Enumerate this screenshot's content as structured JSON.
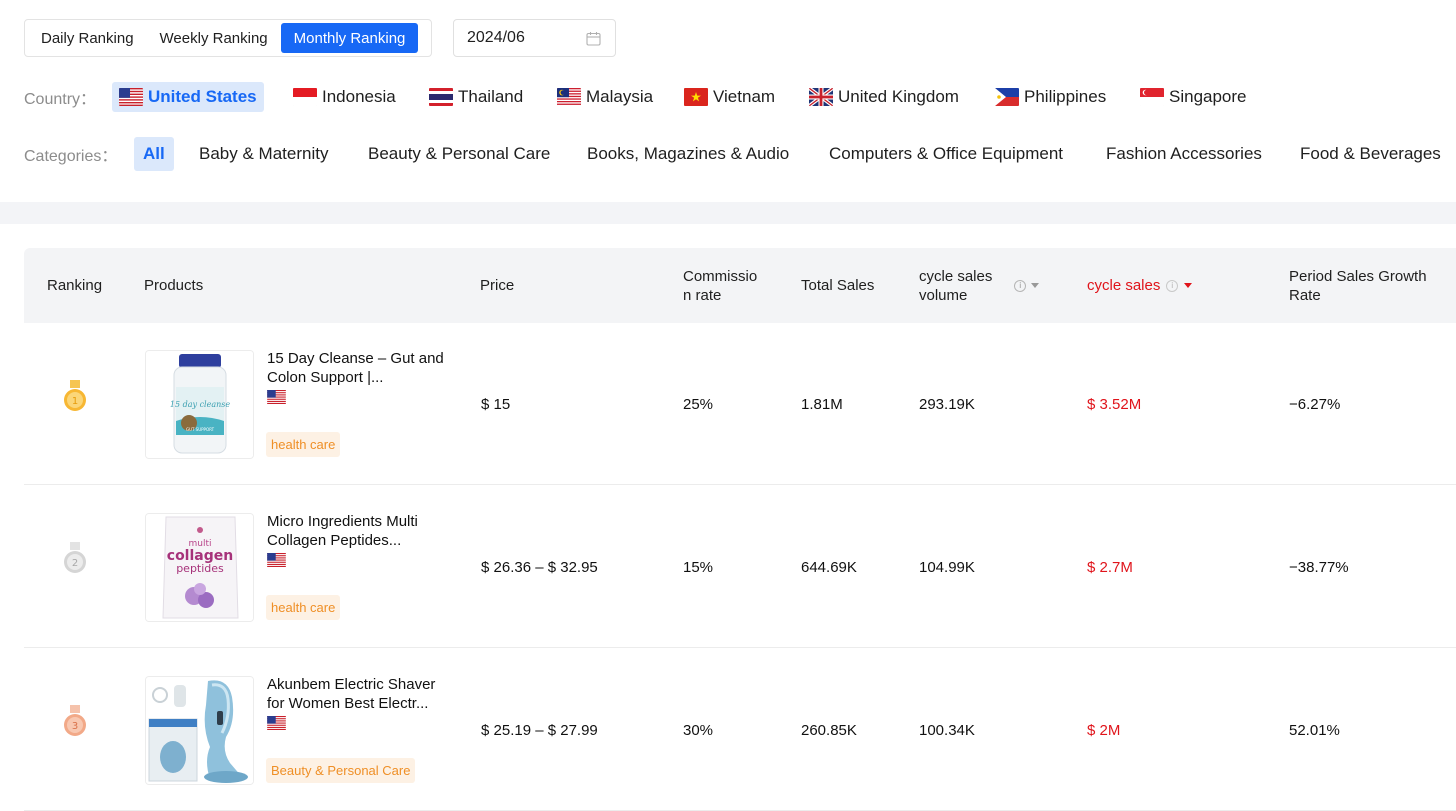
{
  "ranking_tabs": [
    {
      "label": "Daily Ranking",
      "active": false
    },
    {
      "label": "Weekly Ranking",
      "active": false
    },
    {
      "label": "Monthly Ranking",
      "active": true
    }
  ],
  "date_picker": {
    "value": "2024/06",
    "icon": "calendar-icon"
  },
  "country": {
    "label": "Country：",
    "items": [
      {
        "label": "United States",
        "flag": "us",
        "active": true
      },
      {
        "label": "Indonesia",
        "flag": "id",
        "active": false
      },
      {
        "label": "Thailand",
        "flag": "th",
        "active": false
      },
      {
        "label": "Malaysia",
        "flag": "my",
        "active": false
      },
      {
        "label": "Vietnam",
        "flag": "vn",
        "active": false
      },
      {
        "label": "United Kingdom",
        "flag": "gb",
        "active": false
      },
      {
        "label": "Philippines",
        "flag": "ph",
        "active": false
      },
      {
        "label": "Singapore",
        "flag": "sg",
        "active": false
      }
    ]
  },
  "categories": {
    "label": "Categories：",
    "items": [
      {
        "label": "All",
        "active": true
      },
      {
        "label": "Baby & Maternity",
        "active": false
      },
      {
        "label": "Beauty & Personal Care",
        "active": false
      },
      {
        "label": "Books, Magazines & Audio",
        "active": false
      },
      {
        "label": "Computers & Office Equipment",
        "active": false
      },
      {
        "label": "Fashion Accessories",
        "active": false
      },
      {
        "label": "Food & Beverages",
        "active": false
      }
    ]
  },
  "table": {
    "headers": {
      "ranking": "Ranking",
      "products": "Products",
      "price": "Price",
      "commission_line1": "Commissio",
      "commission_line2": "n rate",
      "total_sales": "Total Sales",
      "cycle_volume_line1": "cycle sales",
      "cycle_volume_line2": "volume",
      "cycle_sales": "cycle sales",
      "growth_line1": "Period Sales Growth",
      "growth_line2": "Rate"
    },
    "rows": [
      {
        "rank": "1",
        "medal": "gold",
        "name": "15 Day Cleanse – Gut and Colon Support |...",
        "tag": "health care",
        "price": "$ 15",
        "commission": "25%",
        "total_sales": "1.81M",
        "cycle_volume": "293.19K",
        "cycle_sales": "$ 3.52M",
        "growth": "−6.27%"
      },
      {
        "rank": "2",
        "medal": "silver",
        "name": "Micro Ingredients Multi Collagen Peptides...",
        "tag": "health care",
        "price": "$ 26.36 – $ 32.95",
        "commission": "15%",
        "total_sales": "644.69K",
        "cycle_volume": "104.99K",
        "cycle_sales": "$ 2.7M",
        "growth": "−38.77%"
      },
      {
        "rank": "3",
        "medal": "bronze",
        "name": "Akunbem Electric Shaver for Women Best Electr...",
        "tag": "Beauty & Personal Care",
        "price": "$ 25.19 – $ 27.99",
        "commission": "30%",
        "total_sales": "260.85K",
        "cycle_volume": "100.34K",
        "cycle_sales": "$ 2M",
        "growth": "52.01%"
      }
    ]
  },
  "colors": {
    "accent": "#1768f5",
    "active_bg": "#dbe8fb",
    "highlight_red": "#e0141b",
    "tag_bg": "#fdf1e4",
    "tag_text": "#ef8f26"
  },
  "thumbnails": {
    "row1": {
      "brand_text": "15 day cleanse",
      "label_text": "GUT SUPPORT"
    },
    "row2": {
      "line1": "multi",
      "line2": "collagen",
      "line3": "peptides"
    }
  }
}
